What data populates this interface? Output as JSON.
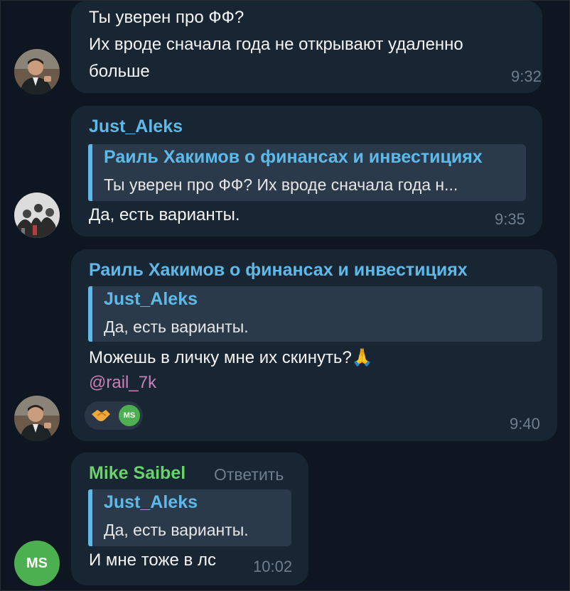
{
  "messages": [
    {
      "lines": [
        "Ты уверен про ФФ?",
        "Их вроде сначала года не открывают удаленно",
        "больше"
      ],
      "time": "9:32"
    },
    {
      "sender": "Just_Aleks",
      "reply": {
        "title": "Раиль Хакимов о финансах и инвестициях",
        "text": "Ты уверен про ФФ? Их вроде сначала года н..."
      },
      "text": "Да, есть варианты.",
      "time": "9:35"
    },
    {
      "sender": "Раиль Хакимов о финансах и инвестициях",
      "reply": {
        "title": "Just_Aleks",
        "text": "Да, есть варианты."
      },
      "text": "Можешь в личку мне их скинуть?",
      "emoji": "🙏",
      "mention": "@rail_7k",
      "reaction_initials": "MS",
      "time": "9:40"
    },
    {
      "sender": "Mike Saibel",
      "reply_action": "Ответить",
      "reply": {
        "title": "Just_Aleks",
        "text": "Да, есть варианты."
      },
      "text": "И мне тоже в лс",
      "time": "10:02",
      "avatar_initials": "MS"
    }
  ],
  "colors": {
    "background": "#0e1621",
    "bubble": "#182533",
    "name_blue": "#5fb9e8",
    "name_green": "#6ad26a",
    "mention": "#c87fb3"
  }
}
